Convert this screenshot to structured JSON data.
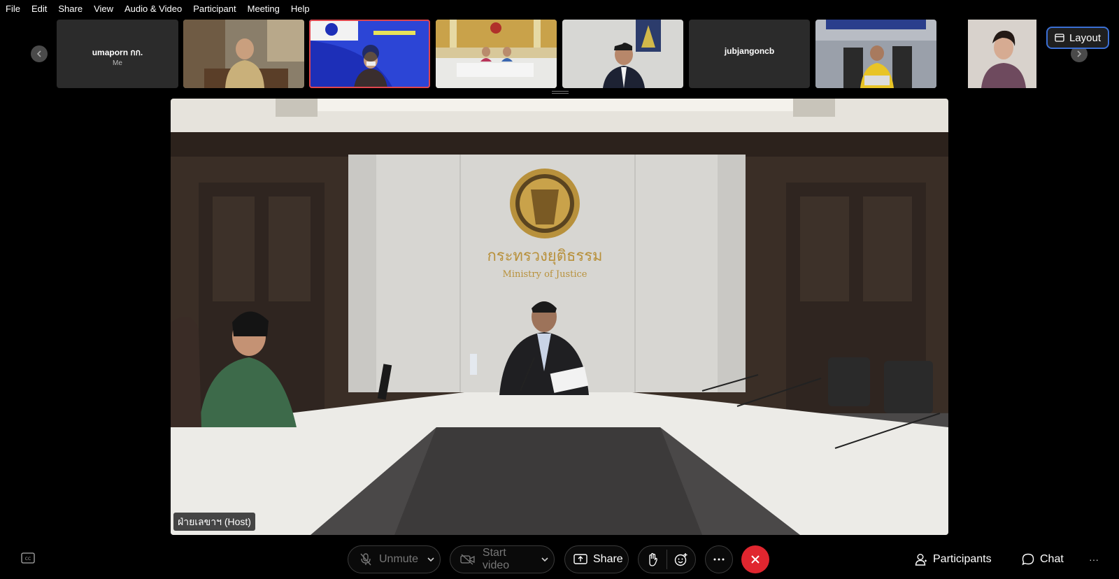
{
  "menu": [
    "File",
    "Edit",
    "Share",
    "View",
    "Audio & Video",
    "Participant",
    "Meeting",
    "Help"
  ],
  "thumbnails": [
    {
      "name": "umaporn กก.",
      "sub": "Me",
      "type": "text"
    },
    {
      "name": "",
      "type": "video"
    },
    {
      "name": "",
      "type": "video",
      "active": true
    },
    {
      "name": "",
      "type": "video"
    },
    {
      "name": "",
      "type": "video"
    },
    {
      "name": "jubjangoncb",
      "sub": "",
      "type": "text"
    },
    {
      "name": "",
      "type": "video"
    },
    {
      "name": "",
      "type": "video"
    }
  ],
  "layout_label": "Layout",
  "main": {
    "wall_text_th": "กระทรวงยุติธรรม",
    "wall_text_en": "Ministry of Justice",
    "host_label": "ฝ่ายเลขาฯ (Host)"
  },
  "toolbar": {
    "unmute": "Unmute",
    "start_video": "Start video",
    "share": "Share",
    "participants": "Participants",
    "chat": "Chat",
    "more": "···"
  },
  "colors": {
    "end_red": "#e0262f",
    "layout_border": "#3b6fd4",
    "active_thumb": "#e0464d"
  }
}
